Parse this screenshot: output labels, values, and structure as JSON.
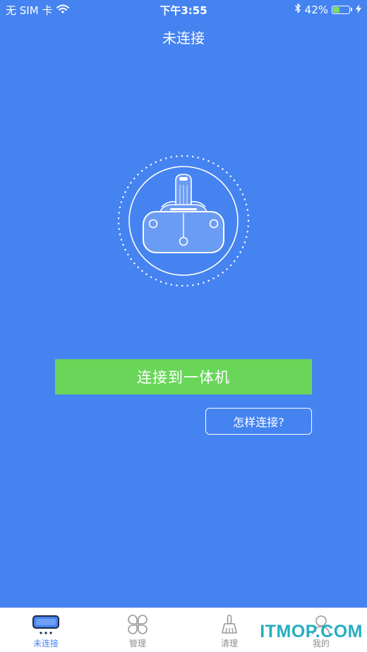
{
  "status_bar": {
    "carrier": "无 SIM 卡",
    "time": "下午3:55",
    "battery_percent_label": "42%",
    "battery_level": 0.42,
    "icons": [
      "wifi-icon",
      "bluetooth-icon",
      "battery-icon",
      "charging-bolt-icon"
    ]
  },
  "header": {
    "title": "未连接"
  },
  "main": {
    "device_icon": "vr-headset-icon",
    "connect_button_label": "连接到一体机",
    "how_button_label": "怎样连接?"
  },
  "tabs": [
    {
      "label": "未连接",
      "icon": "vr-headset-icon",
      "active": true
    },
    {
      "label": "管理",
      "icon": "clover-grid-icon",
      "active": false
    },
    {
      "label": "清理",
      "icon": "broom-icon",
      "active": false
    },
    {
      "label": "我的",
      "icon": "user-icon",
      "active": false
    }
  ],
  "watermark": "ITMOP.COM",
  "colors": {
    "background": "#4583f1",
    "button_green": "#69d659",
    "tab_active": "#4583f1",
    "tab_inactive": "#8f8f8f",
    "battery_fill": "#7be05d",
    "watermark": "#25aec0"
  }
}
